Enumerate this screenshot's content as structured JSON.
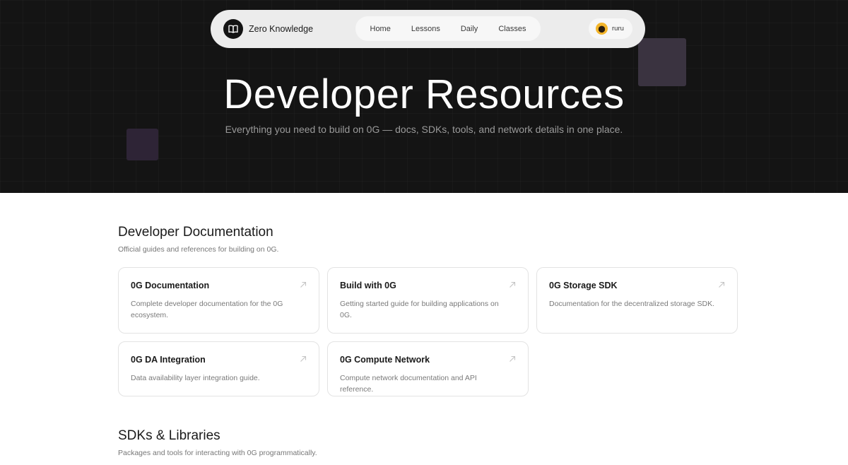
{
  "navbar": {
    "brand_name": "Zero Knowledge",
    "links": [
      "Home",
      "Lessons",
      "Daily",
      "Classes"
    ],
    "user_name": "ruru"
  },
  "hero": {
    "title": "Developer Resources",
    "subtitle": "Everything you need to build on 0G — docs, SDKs, tools, and network details in one place."
  },
  "sections": [
    {
      "title": "Developer Documentation",
      "subtitle": "Official guides and references for building on 0G.",
      "cards": [
        {
          "title": "0G Documentation",
          "desc": "Complete developer documentation for the 0G ecosystem."
        },
        {
          "title": "Build with 0G",
          "desc": "Getting started guide for building applications on 0G."
        },
        {
          "title": "0G Storage SDK",
          "desc": "Documentation for the decentralized storage SDK."
        },
        {
          "title": "0G DA Integration",
          "desc": "Data availability layer integration guide."
        },
        {
          "title": "0G Compute Network",
          "desc": "Compute network documentation and API reference."
        }
      ]
    },
    {
      "title": "SDKs & Libraries",
      "subtitle": "Packages and tools for interacting with 0G programmatically."
    }
  ],
  "colors": {
    "hero_bg": "#141414",
    "accent_square_1": "#3a3340",
    "accent_square_2": "#2e2436"
  }
}
